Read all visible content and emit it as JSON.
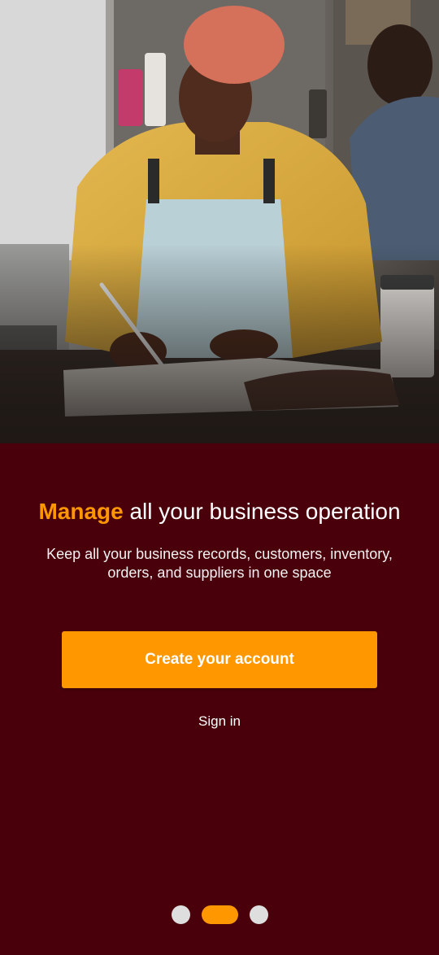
{
  "onboarding": {
    "headline_accent": "Manage",
    "headline_rest": " all your business operation",
    "subtitle": "Keep all your business records, customers, inventory, orders, and suppliers in one space",
    "create_account_label": "Create your account",
    "sign_in_label": "Sign in"
  },
  "pager": {
    "total": 3,
    "active_index": 1
  },
  "colors": {
    "background": "#4a000b",
    "accent": "#ff9800",
    "text": "#ffffff",
    "dot_inactive": "#dedede"
  }
}
